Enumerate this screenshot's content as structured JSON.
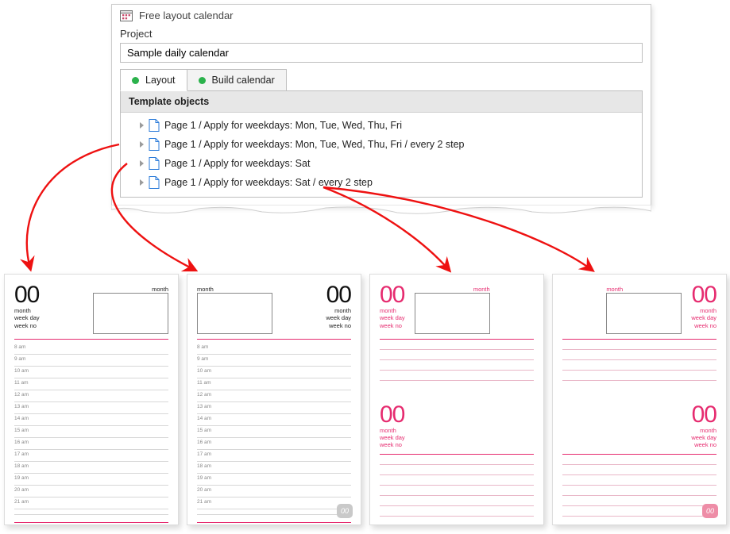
{
  "window": {
    "title": "Free layout calendar"
  },
  "project": {
    "label": "Project",
    "value": "Sample daily calendar"
  },
  "tabs": [
    {
      "label": "Layout",
      "active": true
    },
    {
      "label": "Build calendar",
      "active": false
    }
  ],
  "list": {
    "header": "Template objects",
    "rows": [
      "Page 1 / Apply for weekdays: Mon, Tue, Wed, Thu, Fri",
      "Page 1 / Apply for weekdays: Mon, Tue, Wed, Thu, Fri / every 2 step",
      "Page 1 / Apply for weekdays: Sat",
      "Page 1 / Apply for weekdays: Sat / every 2 step"
    ]
  },
  "previews": {
    "bignum": "00",
    "month_label": "month",
    "meta_lines": {
      "l1": "month",
      "l2": "week day",
      "l3": "week no"
    },
    "hours": [
      "8",
      "9",
      "10",
      "11",
      "12",
      "13",
      "14",
      "15",
      "16",
      "17",
      "18",
      "19",
      "20",
      "21"
    ],
    "am_suffix": " am",
    "badge_text": "00"
  }
}
